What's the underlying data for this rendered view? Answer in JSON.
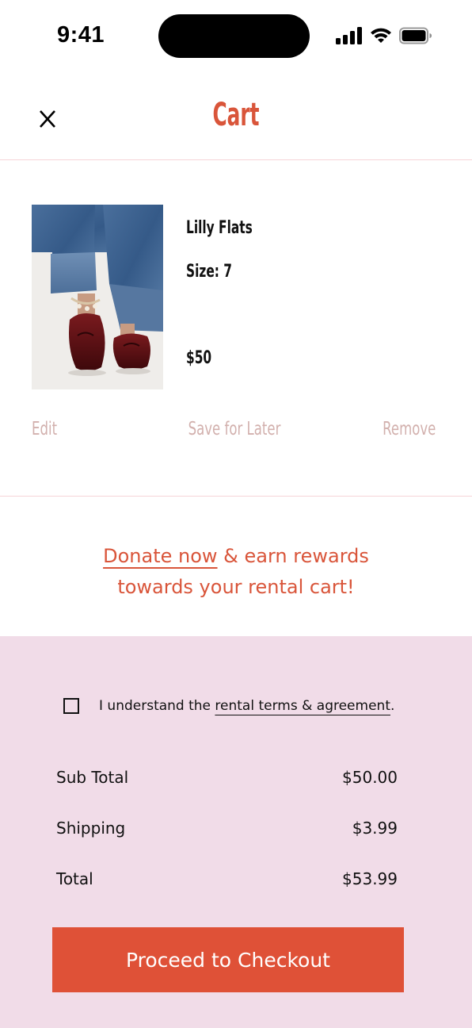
{
  "status_bar": {
    "time": "9:41"
  },
  "header": {
    "title": "Cart",
    "close_label": "X"
  },
  "cart_item": {
    "name": "Lilly Flats",
    "size": "Size: 7",
    "price": "$50",
    "actions": {
      "edit": "Edit",
      "save_for_later": "Save for Later",
      "remove": "Remove"
    }
  },
  "donate": {
    "link_text": "Donate now",
    "line1_rest": " & earn rewards",
    "line2": "towards your rental cart!"
  },
  "summary": {
    "agreement_prefix": "I understand the ",
    "agreement_link": "rental terms & agreement",
    "agreement_suffix": ".",
    "agreement_checked": false,
    "subtotal_label": "Sub Total",
    "subtotal_value": "$50.00",
    "shipping_label": "Shipping",
    "shipping_value": "$3.99",
    "total_label": "Total",
    "total_value": "$53.99",
    "checkout_label": "Proceed to Checkout"
  },
  "colors": {
    "accent": "#d9553a",
    "button": "#df5137",
    "summary_bg": "#f1dce8",
    "action_text": "#d2b0ad",
    "divider": "#f6d4d8"
  },
  "icons": [
    "signal-icon",
    "wifi-icon",
    "battery-icon",
    "close-icon",
    "checkbox-icon"
  ]
}
